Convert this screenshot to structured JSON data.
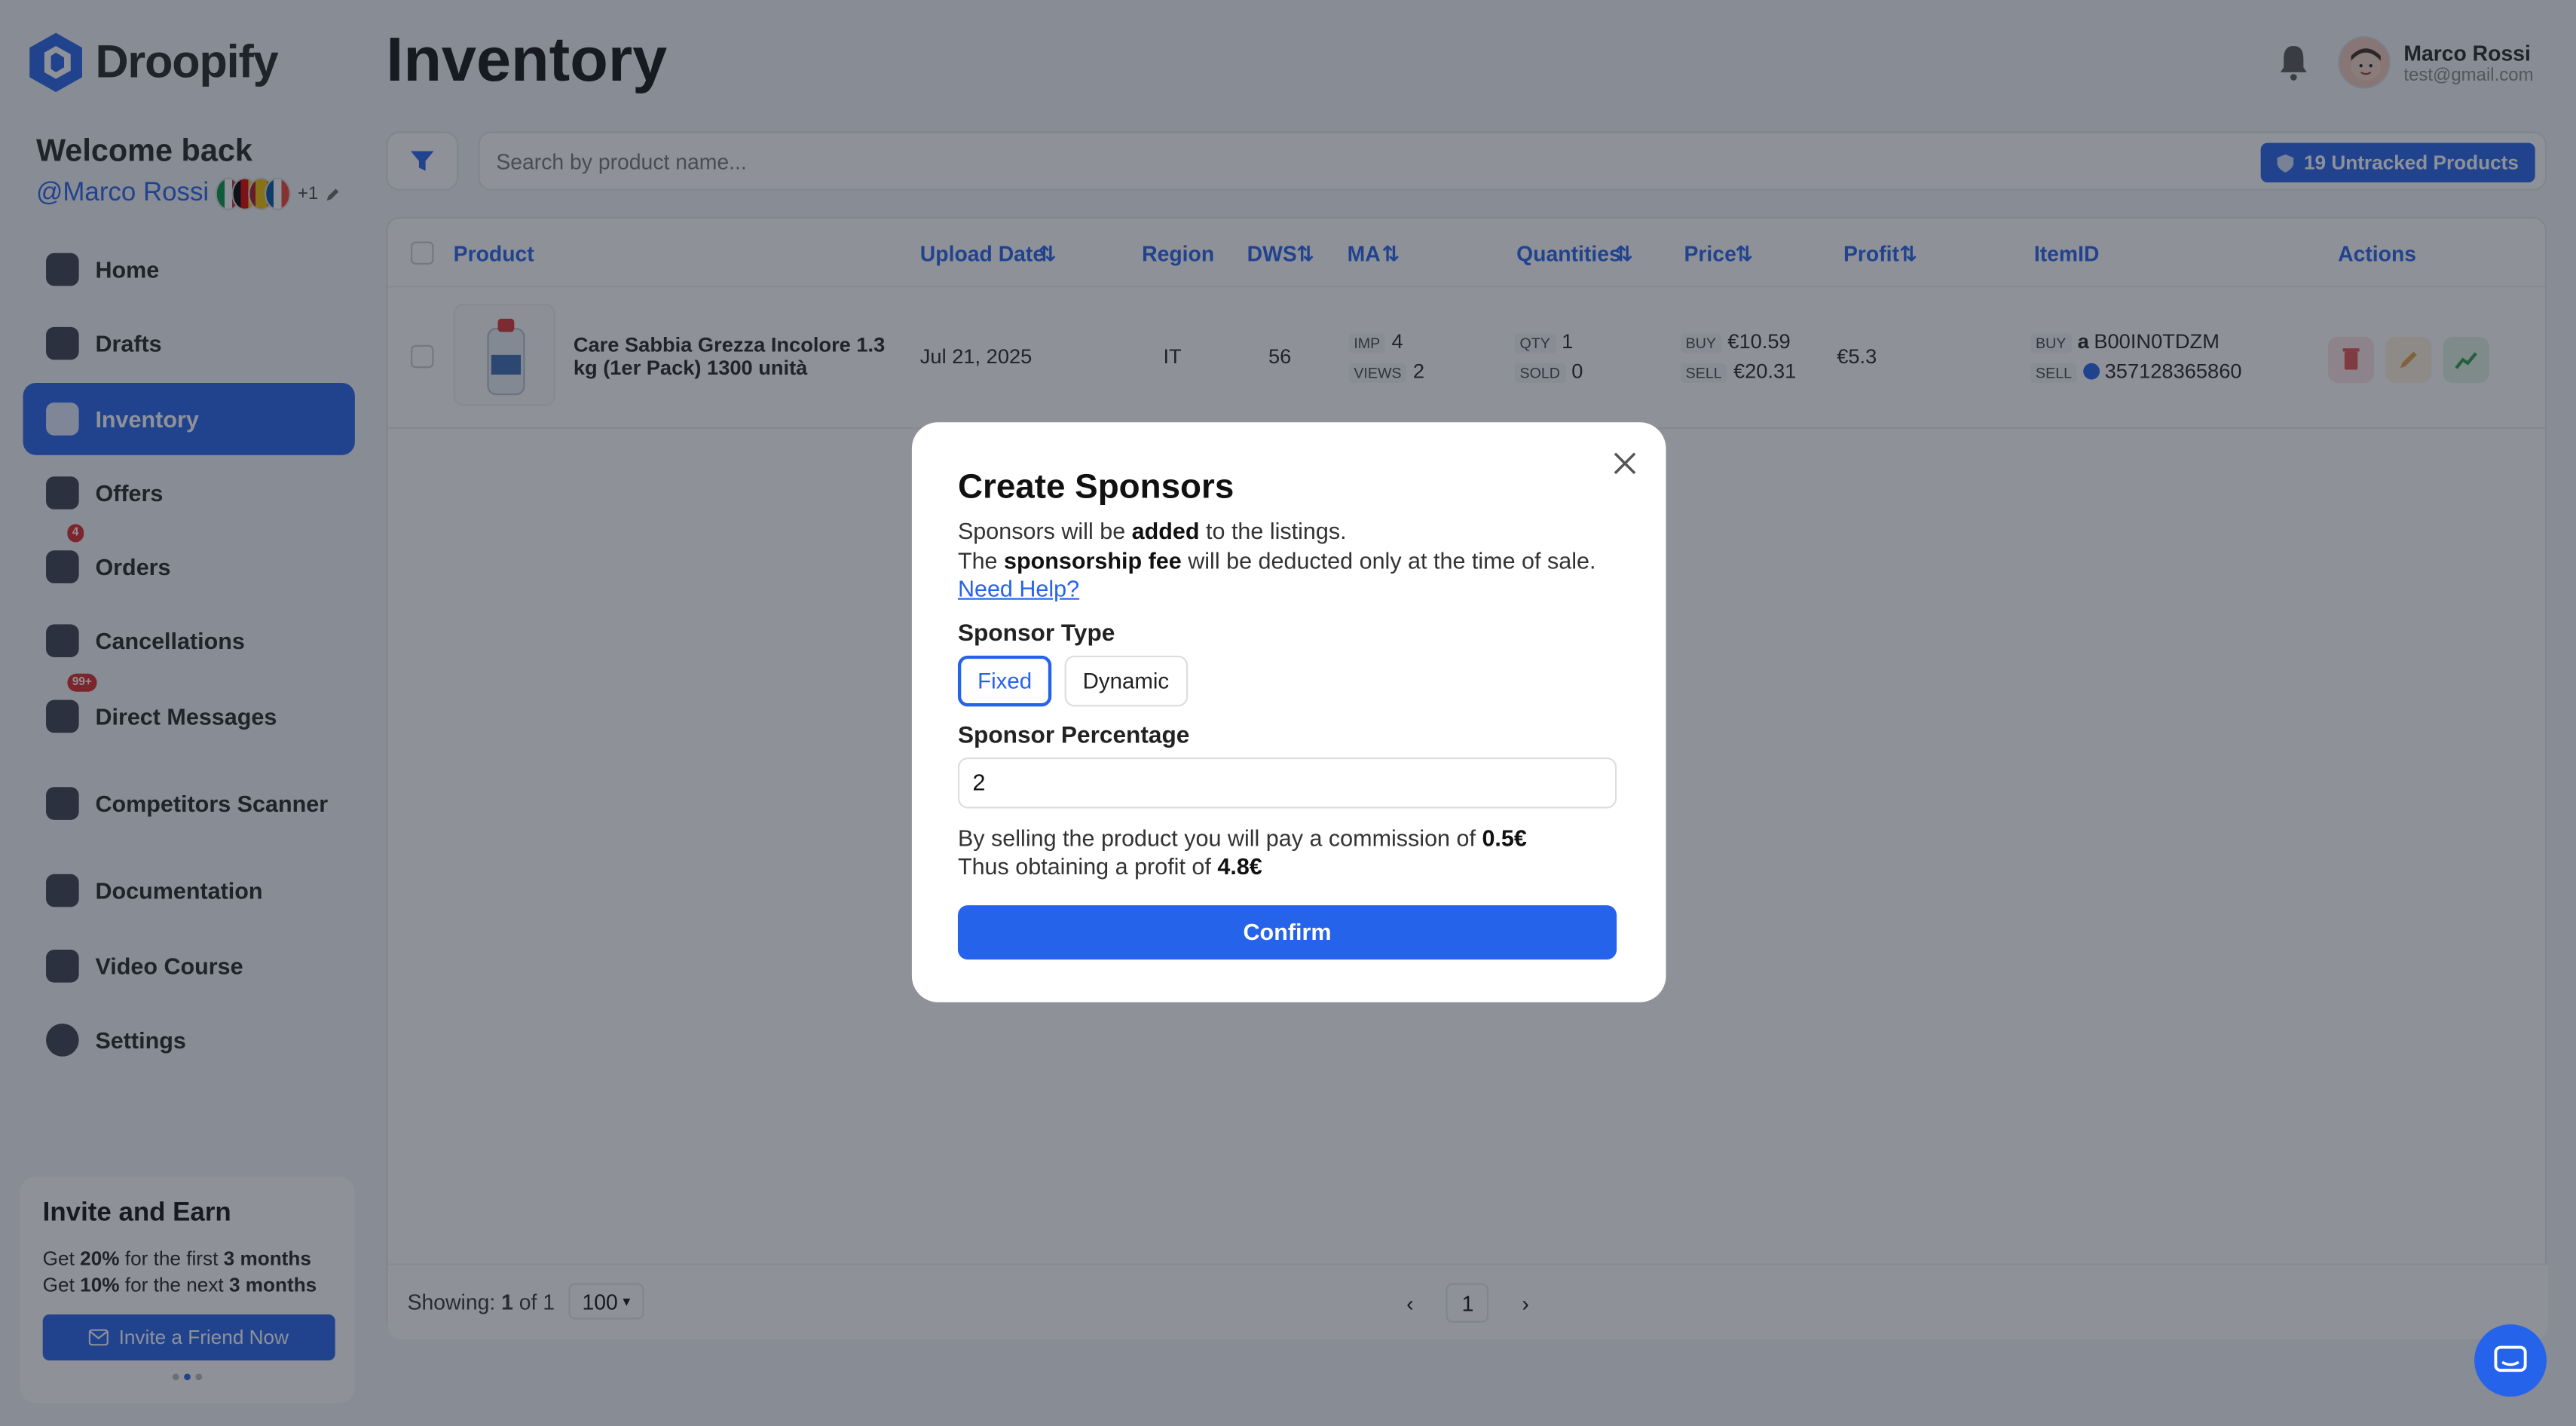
{
  "brand": {
    "name": "Droopify"
  },
  "sidebar": {
    "welcome": "Welcome back",
    "handle": "@Marco Rossi",
    "extra": "+1",
    "items": [
      {
        "label": "Home",
        "icon": "home-icon"
      },
      {
        "label": "Drafts",
        "icon": "drafts-icon"
      },
      {
        "label": "Inventory",
        "icon": "inventory-icon",
        "active": true
      },
      {
        "label": "Offers",
        "icon": "offers-icon"
      },
      {
        "label": "Orders",
        "icon": "cart-icon",
        "badge": "4"
      },
      {
        "label": "Cancellations",
        "icon": "cancel-icon"
      },
      {
        "label": "Direct Messages",
        "icon": "messages-icon",
        "badge": "99+"
      },
      {
        "label": "Competitors Scanner",
        "icon": "scanner-icon"
      },
      {
        "label": "Documentation",
        "icon": "document-icon"
      },
      {
        "label": "Video Course",
        "icon": "book-icon"
      },
      {
        "label": "Settings",
        "icon": "gear-icon"
      }
    ],
    "invite": {
      "title": "Invite and Earn",
      "line1_pre": "Get ",
      "line1_pct": "20%",
      "line1_mid": " for the first ",
      "line1_dur": "3 months",
      "line2_pre": "Get ",
      "line2_pct": "10%",
      "line2_mid": " for the next ",
      "line2_dur": "3 months",
      "button": "Invite a Friend Now"
    }
  },
  "header": {
    "title": "Inventory",
    "user_name": "Marco Rossi",
    "user_email": "test@gmail.com"
  },
  "toolbar": {
    "search_placeholder": "Search by product name...",
    "untracked": "19 Untracked Products"
  },
  "table": {
    "columns": [
      "Product",
      "Upload Date",
      "Region",
      "DWS",
      "MA",
      "Quantities",
      "Price",
      "Profit",
      "ItemID",
      "Actions"
    ],
    "rows": [
      {
        "product": "Care Sabbia Grezza Incolore 1.3 kg (1er Pack) 1300 unità",
        "upload_date": "Jul 21, 2025",
        "region": "IT",
        "dws": "56",
        "imp_label": "IMP",
        "imp": "4",
        "views_label": "VIEWS",
        "views": "2",
        "qty_label": "QTY",
        "qty": "1",
        "sold_label": "SOLD",
        "sold": "0",
        "buy_label": "BUY",
        "buy": "€10.59",
        "sell_label": "SELL",
        "sell": "€20.31",
        "profit": "€5.3",
        "item_buy_label": "BUY",
        "item_buy": "B00IN0TDZM",
        "item_sell_label": "SELL",
        "item_sell": "357128365860"
      }
    ]
  },
  "footer": {
    "showing_pre": "Showing: ",
    "showing_a": "1",
    "showing_of": " of ",
    "showing_b": "1",
    "per_page": "100",
    "page": "1"
  },
  "modal": {
    "title": "Create Sponsors",
    "line1_pre": "Sponsors will be ",
    "line1_bold": "added",
    "line1_post": " to the listings.",
    "line2_pre": "The ",
    "line2_bold": "sponsorship fee",
    "line2_post": " will be deducted only at the time of sale. ",
    "help": "Need Help?",
    "type_label": "Sponsor Type",
    "type_fixed": "Fixed",
    "type_dynamic": "Dynamic",
    "pct_label": "Sponsor Percentage",
    "pct_value": "2",
    "comm_pre": "By selling the product you will pay a commission of ",
    "comm_val": "0.5€",
    "profit_pre": "Thus obtaining a profit of ",
    "profit_val": "4.8€",
    "confirm": "Confirm"
  },
  "colors": {
    "accent": "#2563eb",
    "danger": "#dc2626"
  }
}
